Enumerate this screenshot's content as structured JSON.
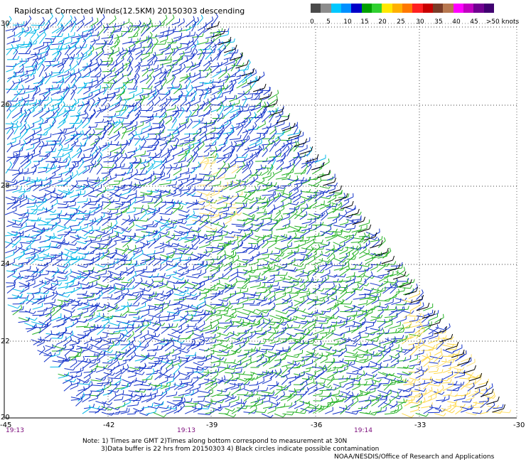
{
  "title": "Rapidscat Corrected Winds(12.5KM) 20150303 descending",
  "colorbar": {
    "colors": [
      "#4a4a4a",
      "#8c8c8c",
      "#00c8ff",
      "#0090ff",
      "#0000c8",
      "#00a000",
      "#30d030",
      "#ffe800",
      "#ffb000",
      "#ff7800",
      "#ff2020",
      "#c80000",
      "#7a3c28",
      "#b87850",
      "#ff00ff",
      "#c000c0",
      "#700090",
      "#400070"
    ],
    "labels": [
      "0",
      "5",
      "10",
      "15",
      "20",
      "25",
      "30",
      "35",
      "40",
      "45",
      ">50 knots"
    ]
  },
  "lat_labels": [
    "30",
    "26",
    "26",
    "28",
    "24",
    "22",
    "20"
  ],
  "lon_labels": [
    "-45",
    "-42",
    "-39",
    "-36",
    "-33",
    "-30"
  ],
  "time_labels": [
    "19:13",
    "19:13",
    "19:14"
  ],
  "notes": {
    "line1": "Note: 1) Times are GMT 2)Times along bottom correspond to measurement at 30N",
    "line2": "3)Data buffer is 22 hrs from 20150303 4) Black circles indicate possible contamination",
    "credit": "NOAA/NESDIS/Office of Research and Applications"
  }
}
